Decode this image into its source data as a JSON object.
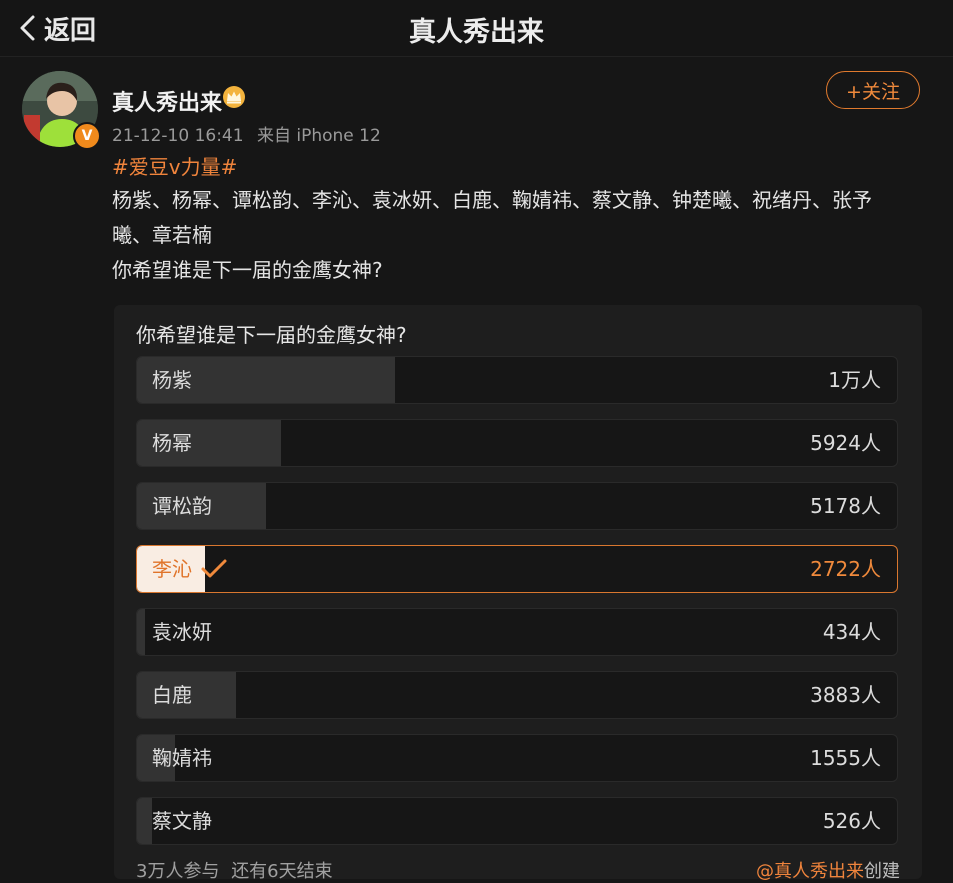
{
  "header": {
    "back_label": "返回",
    "title": "真人秀出来"
  },
  "post": {
    "author": "真人秀出来",
    "verified_badge": "V",
    "time": "21-12-10 16:41",
    "source": "来自 iPhone 12",
    "follow_label": "+关注",
    "topic": "#爱豆v力量#",
    "text_line1": "杨紫、杨幂、谭松韵、李沁、袁冰妍、白鹿、鞠婧祎、蔡文静、钟楚曦、祝绪丹、张予",
    "text_line2": "曦、章若楠",
    "text_line3": "你希望谁是下一届的金鹰女神?"
  },
  "poll": {
    "question": "你希望谁是下一届的金鹰女神?",
    "options": [
      {
        "label": "杨紫",
        "count": "1万人",
        "fraction": 0.34,
        "selected": false
      },
      {
        "label": "杨幂",
        "count": "5924人",
        "fraction": 0.19,
        "selected": false
      },
      {
        "label": "谭松韵",
        "count": "5178人",
        "fraction": 0.17,
        "selected": false
      },
      {
        "label": "李沁",
        "count": "2722人",
        "fraction": 0.09,
        "selected": true
      },
      {
        "label": "袁冰妍",
        "count": "434人",
        "fraction": 0.01,
        "selected": false
      },
      {
        "label": "白鹿",
        "count": "3883人",
        "fraction": 0.13,
        "selected": false
      },
      {
        "label": "鞠婧祎",
        "count": "1555人",
        "fraction": 0.05,
        "selected": false
      },
      {
        "label": "蔡文静",
        "count": "526人",
        "fraction": 0.02,
        "selected": false
      }
    ],
    "participants": "3万人参与",
    "remaining": "还有6天结束",
    "creator": "@真人秀出来",
    "creator_action": "创建"
  },
  "colors": {
    "accent": "#f08a3c",
    "background": "#161616",
    "bar_fill": "#333333",
    "selected_fill": "#f9ede3"
  },
  "icons": {
    "back": "chevron-left-icon",
    "crown": "crown-icon",
    "check": "checkmark-icon"
  }
}
